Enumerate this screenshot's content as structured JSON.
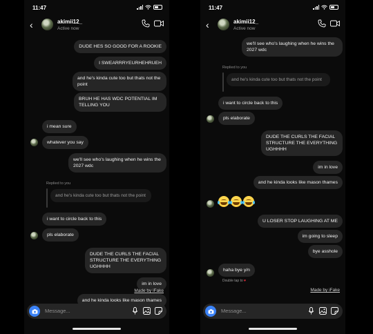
{
  "status": {
    "time": "11:47"
  },
  "header": {
    "username": "akimii12_",
    "active": "Active now"
  },
  "composer": {
    "placeholder": "Message..."
  },
  "watermark": "Made by iFake",
  "reply_label": "Replied to you",
  "double_tap": "Double tap to",
  "icons": [
    "back-chevron-icon",
    "phone-icon",
    "video-icon",
    "camera-icon",
    "microphone-icon",
    "gallery-icon",
    "sticker-icon",
    "signal-icon",
    "wifi-icon",
    "battery-icon",
    "heart-icon"
  ],
  "colors": {
    "background": "#000000",
    "bubble": "#262626",
    "accent": "#3b82f6",
    "heart": "#ff3040"
  },
  "screen1": {
    "messages": [
      {
        "text": "DUDE HES SO GOOD FOR A ROOKIE"
      },
      {
        "text": "I SWEARRRYEURHEHRUEH"
      },
      {
        "text": "and he's kinda cute too but thats not the point"
      },
      {
        "text": "BRUH HE HAS WDC POTENTIAL IM TELLING YOU"
      },
      {
        "text": "i mean sure"
      },
      {
        "text": "whatever you say"
      },
      {
        "text": "we'll see who's laughing when he wins the 2027 wdc"
      },
      {
        "text": "and he's kinda cute too but thats not the point"
      },
      {
        "text": "i want to circle back to this"
      },
      {
        "text": "pls elaborate"
      },
      {
        "text": "DUDE THE CURLS THE FACIAL STRUCTURE THE EVERYTHING UGHHHH"
      },
      {
        "text": "im in love"
      },
      {
        "text": "and he kinda looks like mason thames"
      }
    ]
  },
  "screen2": {
    "messages": [
      {
        "text": "we'll see who's laughing when he wins the 2027 wdc"
      },
      {
        "text": "and he's kinda cute too but thats not the point"
      },
      {
        "text": "i want to circle back to this"
      },
      {
        "text": "pls elaborate"
      },
      {
        "text": "DUDE THE CURLS THE FACIAL STRUCTURE THE EVERYTHING UGHHHH"
      },
      {
        "text": "im in love"
      },
      {
        "text": "and he kinda looks like mason thames"
      },
      {
        "text": "U LOSER STOP LAUGHING AT ME"
      },
      {
        "text": "im going to sleep"
      },
      {
        "text": "bye asshole"
      },
      {
        "text": "haha bye y/n"
      }
    ]
  }
}
